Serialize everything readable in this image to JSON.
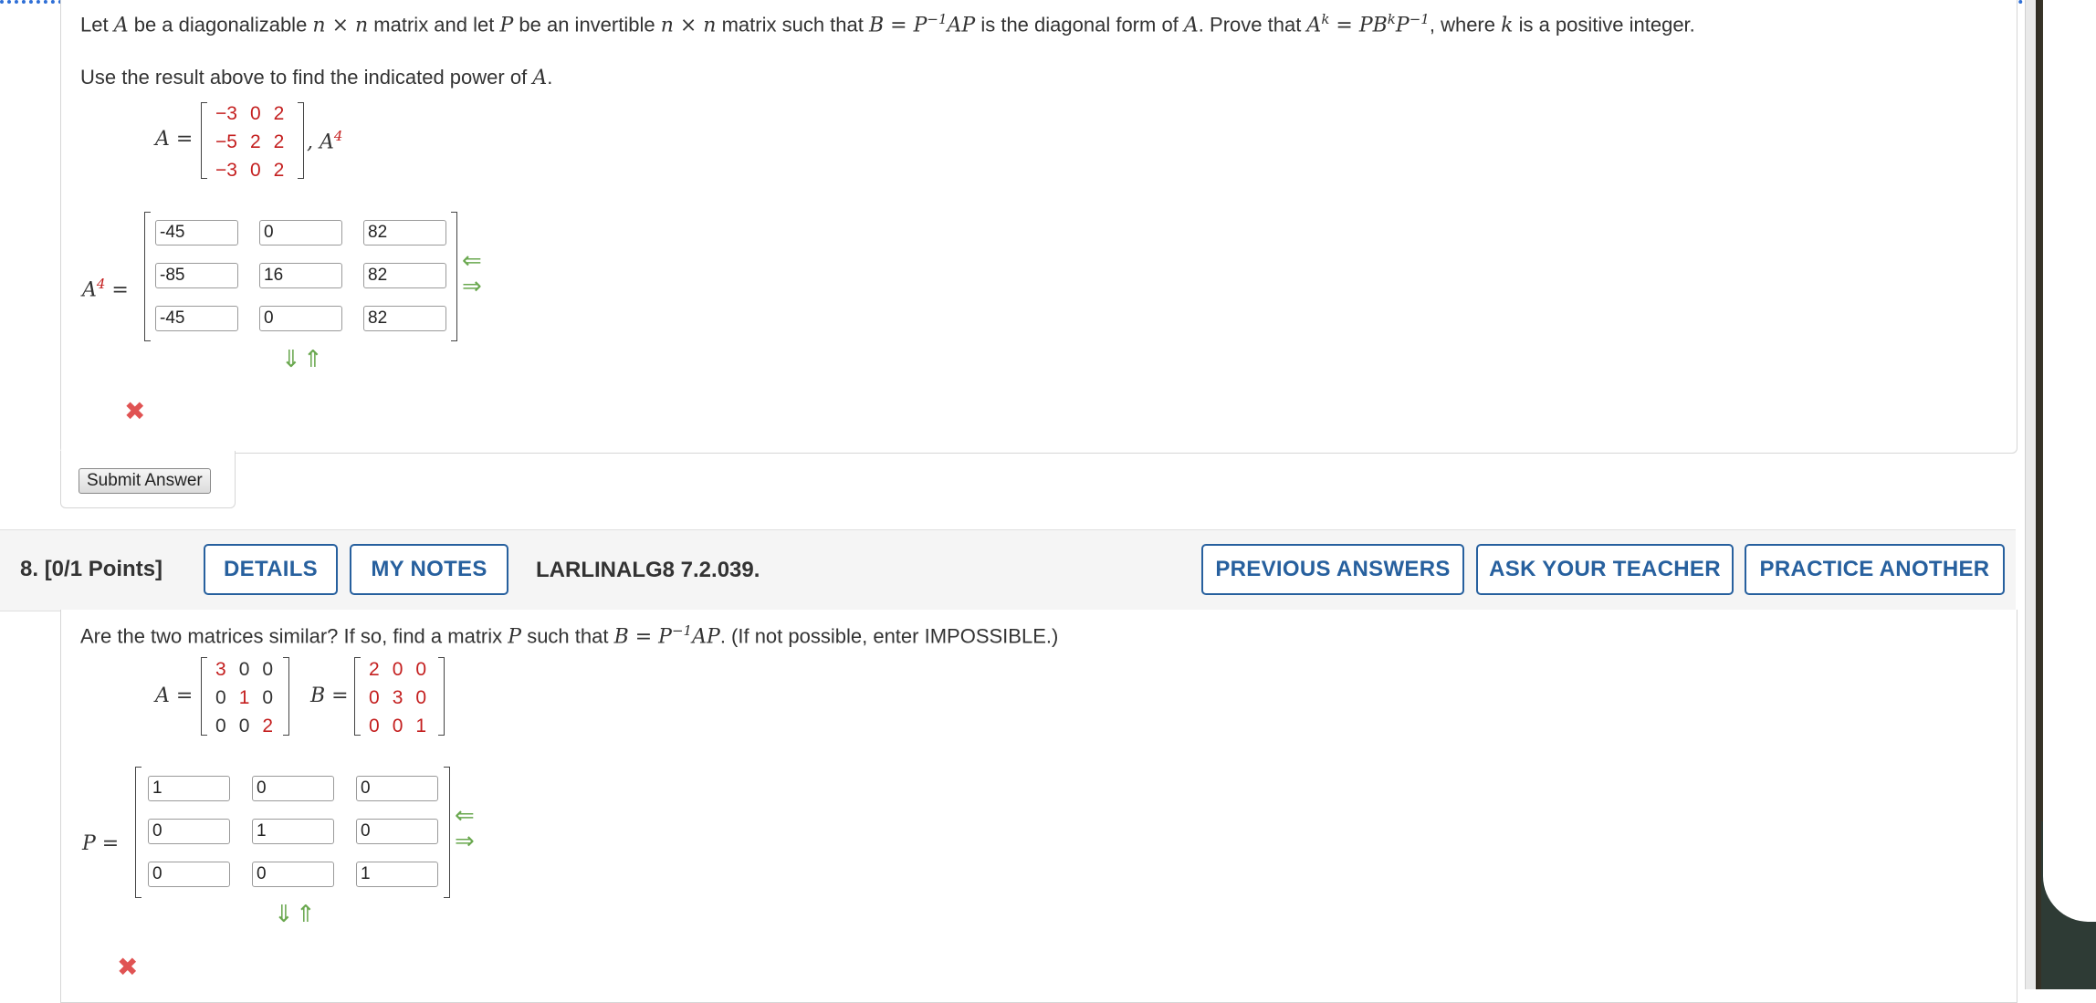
{
  "q7": {
    "stmt": {
      "t1": "Let ",
      "A": "A",
      "t2": " be a diagonalizable ",
      "nxn1": "n × n",
      "t3": " matrix and let ",
      "P": "P",
      "t4": " be an invertible ",
      "nxn2": "n × n",
      "t5": " matrix such that ",
      "eq1": "B = P",
      "eq1sup": "−1",
      "eq1b": "AP",
      "t6": " is the diagonal form of ",
      "A2": "A",
      "t7": ". Prove that ",
      "eq2a": "A",
      "eq2sup": "k",
      "eq2b": " = PB",
      "eq2sup2": "k",
      "eq2c": "P",
      "eq2sup3": "−1",
      "t8": ",",
      "t9": " where ",
      "k": "k",
      "t10": " is a positive integer."
    },
    "instr": {
      "t1": "Use the result above to find the indicated power of ",
      "A": "A",
      "t2": "."
    },
    "matrix_label": "A =",
    "matrix": [
      [
        "−3",
        "0",
        "2"
      ],
      [
        "−5",
        "2",
        "2"
      ],
      [
        "−3",
        "0",
        "2"
      ]
    ],
    "power_label": ", A",
    "power_sup": "4",
    "answer_label_a": "A",
    "answer_label_sup": "4",
    "answer_label_eq": " =",
    "answers": [
      [
        "-45",
        "0",
        "82"
      ],
      [
        "-85",
        "16",
        "82"
      ],
      [
        "-45",
        "0",
        "82"
      ]
    ],
    "submit": "Submit Answer"
  },
  "q8": {
    "number": "8.",
    "points": "[0/1 Points]",
    "details": "DETAILS",
    "notes": "MY NOTES",
    "code": "LARLINALG8 7.2.039.",
    "prev": "PREVIOUS ANSWERS",
    "ask": "ASK YOUR TEACHER",
    "practice": "PRACTICE ANOTHER",
    "q": {
      "t1": "Are the two matrices similar? If so, find a matrix ",
      "P": "P",
      "t2": " such that ",
      "eq": "B = P",
      "sup": "−1",
      "eq2": "AP",
      "t3": ".  (If not possible, enter IMPOSSIBLE.)"
    },
    "A_label": "A =",
    "A": [
      [
        "3",
        "0",
        "0"
      ],
      [
        "0",
        "1",
        "0"
      ],
      [
        "0",
        "0",
        "2"
      ]
    ],
    "B_label": "B =",
    "B": [
      [
        "2",
        "0",
        "0"
      ],
      [
        "0",
        "3",
        "0"
      ],
      [
        "0",
        "0",
        "1"
      ]
    ],
    "P_label": "P =",
    "answers": [
      [
        "1",
        "0",
        "0"
      ],
      [
        "0",
        "1",
        "0"
      ],
      [
        "0",
        "0",
        "1"
      ]
    ]
  },
  "icons": {
    "wrong": "✖",
    "left": "⇐",
    "right": "⇒",
    "down": "⇓",
    "up": "⇑"
  },
  "colors": {
    "accent": "#27609e",
    "red": "#c41f1f",
    "green": "#6aa84f",
    "wrong": "#e05353"
  }
}
